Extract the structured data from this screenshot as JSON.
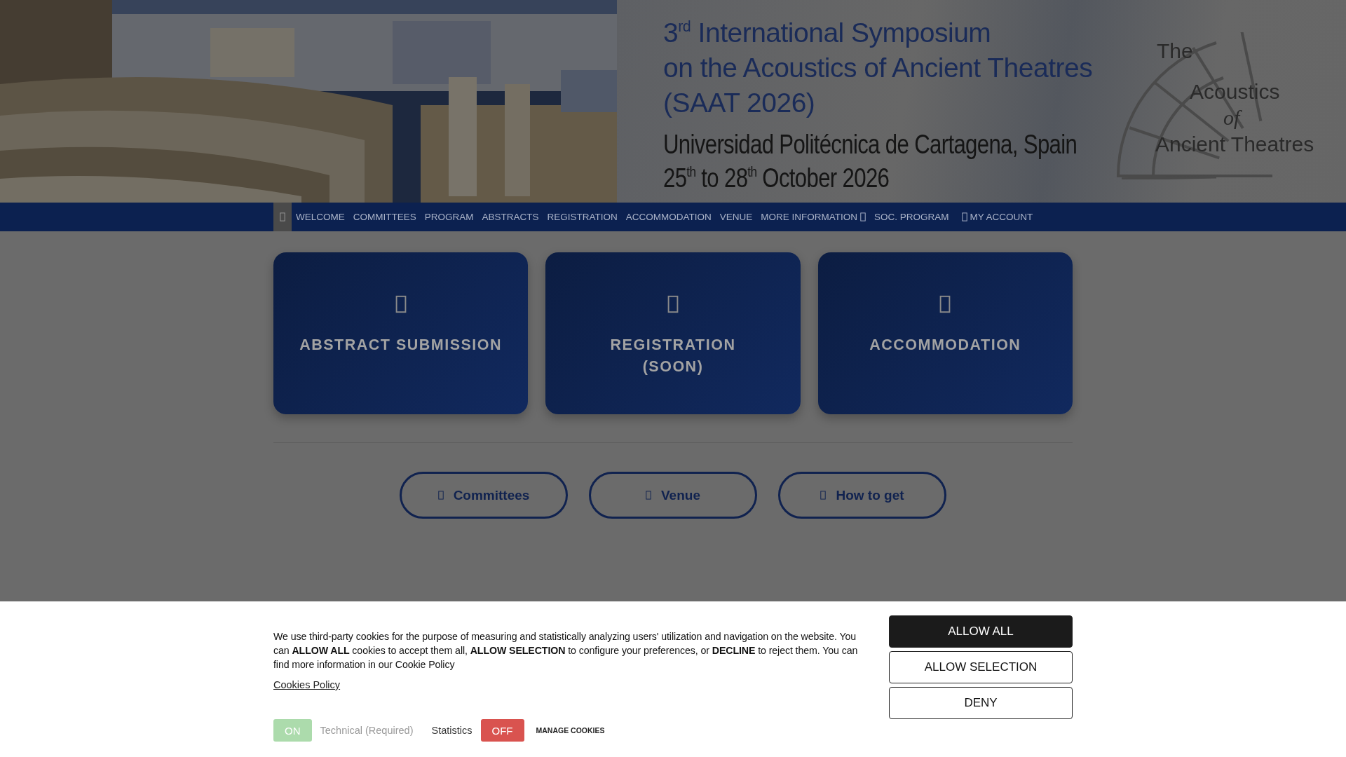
{
  "header": {
    "title_lines": [
      "3$^{rd}$ International Symposium",
      "on the Acoustics of Ancient Theatres",
      "(SAAT 2026)"
    ],
    "subtitle_lines": [
      "Universidad Politécnica de Cartagena, Spain",
      "25$^{th}$ to 28$^{th}$ October 2026"
    ],
    "logo_lines": [
      "The",
      "Acoustics",
      "of",
      "Ancient Theatres"
    ]
  },
  "nav": {
    "home_selected": true,
    "items": [
      {
        "label": "WELCOME",
        "kind": "plain"
      },
      {
        "label": "COMMITTEES",
        "kind": "plain"
      },
      {
        "label": "PROGRAM",
        "kind": "plain"
      },
      {
        "label": "ABSTRACTS",
        "kind": "plain"
      },
      {
        "label": "REGISTRATION",
        "kind": "plain"
      },
      {
        "label": "ACCOMMODATION",
        "kind": "plain"
      },
      {
        "label": "VENUE",
        "kind": "plain"
      },
      {
        "label": "MORE INFORMATION",
        "kind": "dropdown"
      },
      {
        "label": "SOC. PROGRAM",
        "kind": "plain"
      },
      {
        "label": "MY ACCOUNT",
        "kind": "account"
      }
    ]
  },
  "cards": [
    {
      "label": "ABSTRACT SUBMISSION"
    },
    {
      "label": "REGISTRATION\n(SOON)"
    },
    {
      "label": "ACCOMMODATION"
    }
  ],
  "quick_links": [
    {
      "label": "Committees"
    },
    {
      "label": "Venue"
    },
    {
      "label": "How to get"
    }
  ],
  "cookie": {
    "text": "We use third-party cookies for the purpose of measuring and statistically analyzing users' utilization and navigation on the website. You can **ALLOW ALL** cookies to accept them all, **ALLOW SELECTION** to configure your preferences, or **DECLINE** to reject them. You can find more information in our Cookie Policy",
    "policy_link": "Cookies Policy",
    "toggles": [
      {
        "label": "Technical (Required)",
        "on": true,
        "disabled": true,
        "kind": "switch_first",
        "switch_text": "ON"
      },
      {
        "label": "Statistics",
        "on": false,
        "disabled": false,
        "kind": "label_first",
        "switch_text": "OFF"
      }
    ],
    "manage_link": "MANAGE COOKIES",
    "buttons": [
      {
        "label": "ALLOW ALL",
        "kind": "primary"
      },
      {
        "label": "ALLOW SELECTION",
        "kind": "outline"
      },
      {
        "label": "DENY",
        "kind": "outline"
      }
    ]
  }
}
